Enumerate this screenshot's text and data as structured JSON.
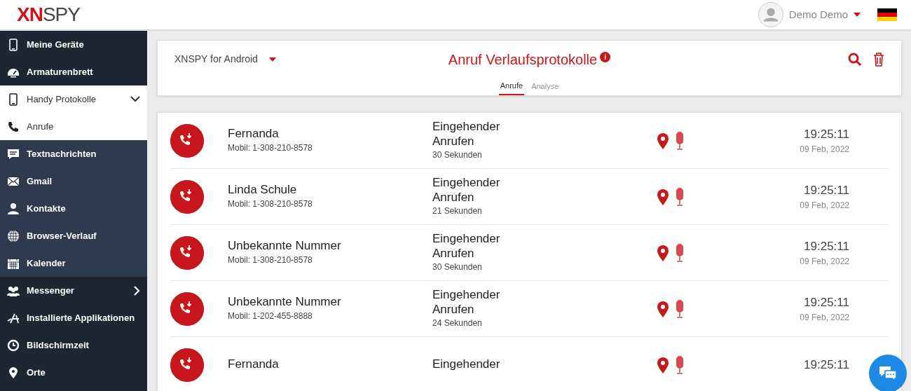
{
  "header": {
    "logo_accent": "XN",
    "logo_rest": "SPY",
    "user": "Demo Demo"
  },
  "sidebar": {
    "items": [
      {
        "label": "Meine Geräte",
        "selected": false
      },
      {
        "label": "Armaturenbrett",
        "selected": false
      },
      {
        "label": "Handy Protokolle",
        "expanded": true,
        "children": [
          {
            "label": "Anrufe",
            "selected": true
          },
          {
            "label": "Textnachrichten",
            "selected": false
          },
          {
            "label": "Gmail",
            "selected": false
          },
          {
            "label": "Kontakte",
            "selected": false
          },
          {
            "label": "Browser-Verlauf",
            "selected": false
          },
          {
            "label": "Kalender",
            "selected": false
          }
        ]
      },
      {
        "label": "Messenger",
        "selected": false,
        "expanded": false
      },
      {
        "label": "Installierte Applikationen",
        "selected": false
      },
      {
        "label": "Bildschirmzeit",
        "selected": false
      },
      {
        "label": "Orte",
        "selected": false
      }
    ]
  },
  "toolbar": {
    "device": "XNSPY for Android",
    "title": "Anruf Verlaufsprotokolle",
    "info": "i",
    "tabs": [
      {
        "label": "Anrufe",
        "selected": true
      },
      {
        "label": "Analyse",
        "selected": false
      }
    ]
  },
  "calls": [
    {
      "name": "Fernanda",
      "number": "Mobil: 1-308-210-8578",
      "type": "Eingehender Anrufen",
      "duration": "30 Sekunden",
      "time": "19:25:11",
      "date": "09 Feb, 2022"
    },
    {
      "name": "Linda Schule",
      "number": "Mobil: 1-308-210-8578",
      "type": "Eingehender Anrufen",
      "duration": "21 Sekunden",
      "time": "19:25:11",
      "date": "09 Feb, 2022"
    },
    {
      "name": "Unbekannte Nummer",
      "number": "Mobil: 1-308-210-8578",
      "type": "Eingehender Anrufen",
      "duration": "30 Sekunden",
      "time": "19:25:11",
      "date": "09 Feb, 2022"
    },
    {
      "name": "Unbekannte Nummer",
      "number": "Mobil: 1-202-455-8888",
      "type": "Eingehender Anrufen",
      "duration": "24 Sekunden",
      "time": "19:25:11",
      "date": "09 Feb, 2022"
    },
    {
      "name": "Fernanda",
      "type": "Eingehender",
      "time": "19:25:11"
    }
  ]
}
